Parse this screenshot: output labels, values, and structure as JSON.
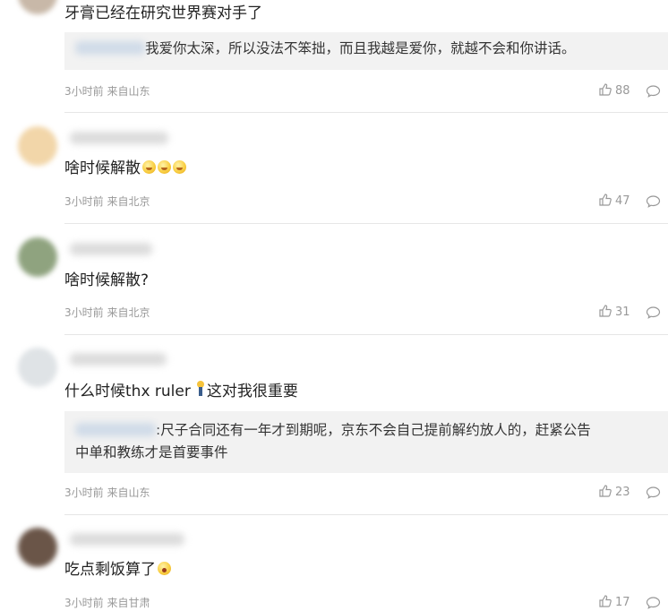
{
  "comments": [
    {
      "text": "牙膏已经在研究世界赛对手了",
      "reply": "我爱你太深，所以没法不笨拙，而且我越是爱你，就越不会和你讲话。",
      "meta": "3小时前 来自山东",
      "likes": "88",
      "avatar_color": "#c8b8a8"
    },
    {
      "text": "啥时候解散",
      "emojis": [
        "smile",
        "smile",
        "smile"
      ],
      "meta": "3小时前 来自北京",
      "likes": "47",
      "avatar_color": "#f2d6a9"
    },
    {
      "text": "啥时候解散?",
      "meta": "3小时前 来自北京",
      "likes": "31",
      "avatar_color": "#8fa37f"
    },
    {
      "text": "什么时候thx ruler",
      "text_after": "这对我很重要",
      "reply": ":尺子合同还有一年才到期呢，京东不会自己提前解约放人的，赶紧公告",
      "reply_line2": "中单和教练才是首要事件",
      "meta": "3小时前 来自山东",
      "likes": "23",
      "avatar_color": "#dfe3e6"
    },
    {
      "text": "吃点剩饭算了",
      "emojis": [
        "wow"
      ],
      "meta": "3小时前 来自甘肃",
      "likes": "17",
      "avatar_color": "#6a5548"
    }
  ],
  "icons": {
    "like": "thumbs-up-icon",
    "comment": "speech-bubble-icon"
  },
  "colors": {
    "meta_text": "#999999",
    "reply_background": "#f2f2f2",
    "divider": "#e6e6e6"
  }
}
